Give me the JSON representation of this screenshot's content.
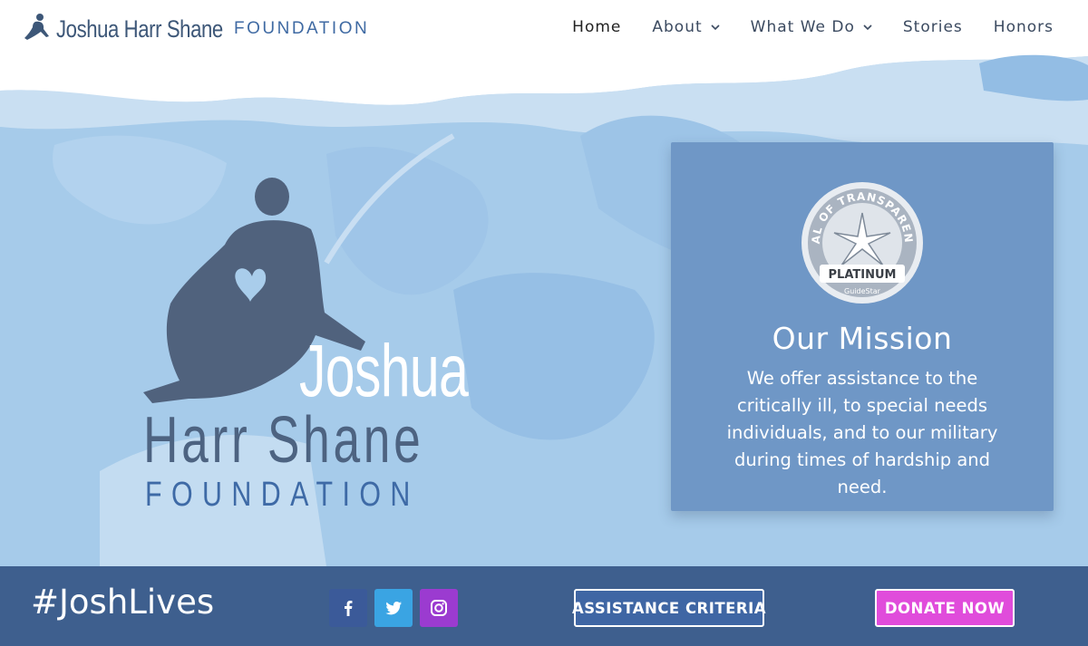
{
  "brand": {
    "name": "Joshua Harr Shane",
    "foundation": "FOUNDATION"
  },
  "nav": {
    "items": [
      {
        "label": "Home",
        "dropdown": false
      },
      {
        "label": "About",
        "dropdown": true
      },
      {
        "label": "What We Do",
        "dropdown": true
      },
      {
        "label": "Stories",
        "dropdown": false
      },
      {
        "label": "Honors",
        "dropdown": false
      }
    ]
  },
  "hero": {
    "logo_first": "Joshua",
    "logo_middle": "Harr Shane",
    "logo_foundation": "FOUNDATION"
  },
  "mission": {
    "seal_top": "SEAL OF TRANSPARENCY",
    "seal_level": "PLATINUM",
    "seal_brand": "GuideStar",
    "title": "Our Mission",
    "text": "We offer assistance to the critically ill, to special needs individuals, and to our military during times of hardship and need."
  },
  "footer": {
    "hashtag": "#JoshLives",
    "social": [
      "facebook-icon",
      "twitter-icon",
      "instagram-icon"
    ],
    "assist_label": "ASSISTANCE CRITERIA",
    "donate_label": "DONATE NOW"
  },
  "colors": {
    "bar": "#3e5f8e",
    "card": "#6f97c6",
    "donate": "#e04cdb",
    "hero": "#a9cdeb"
  }
}
